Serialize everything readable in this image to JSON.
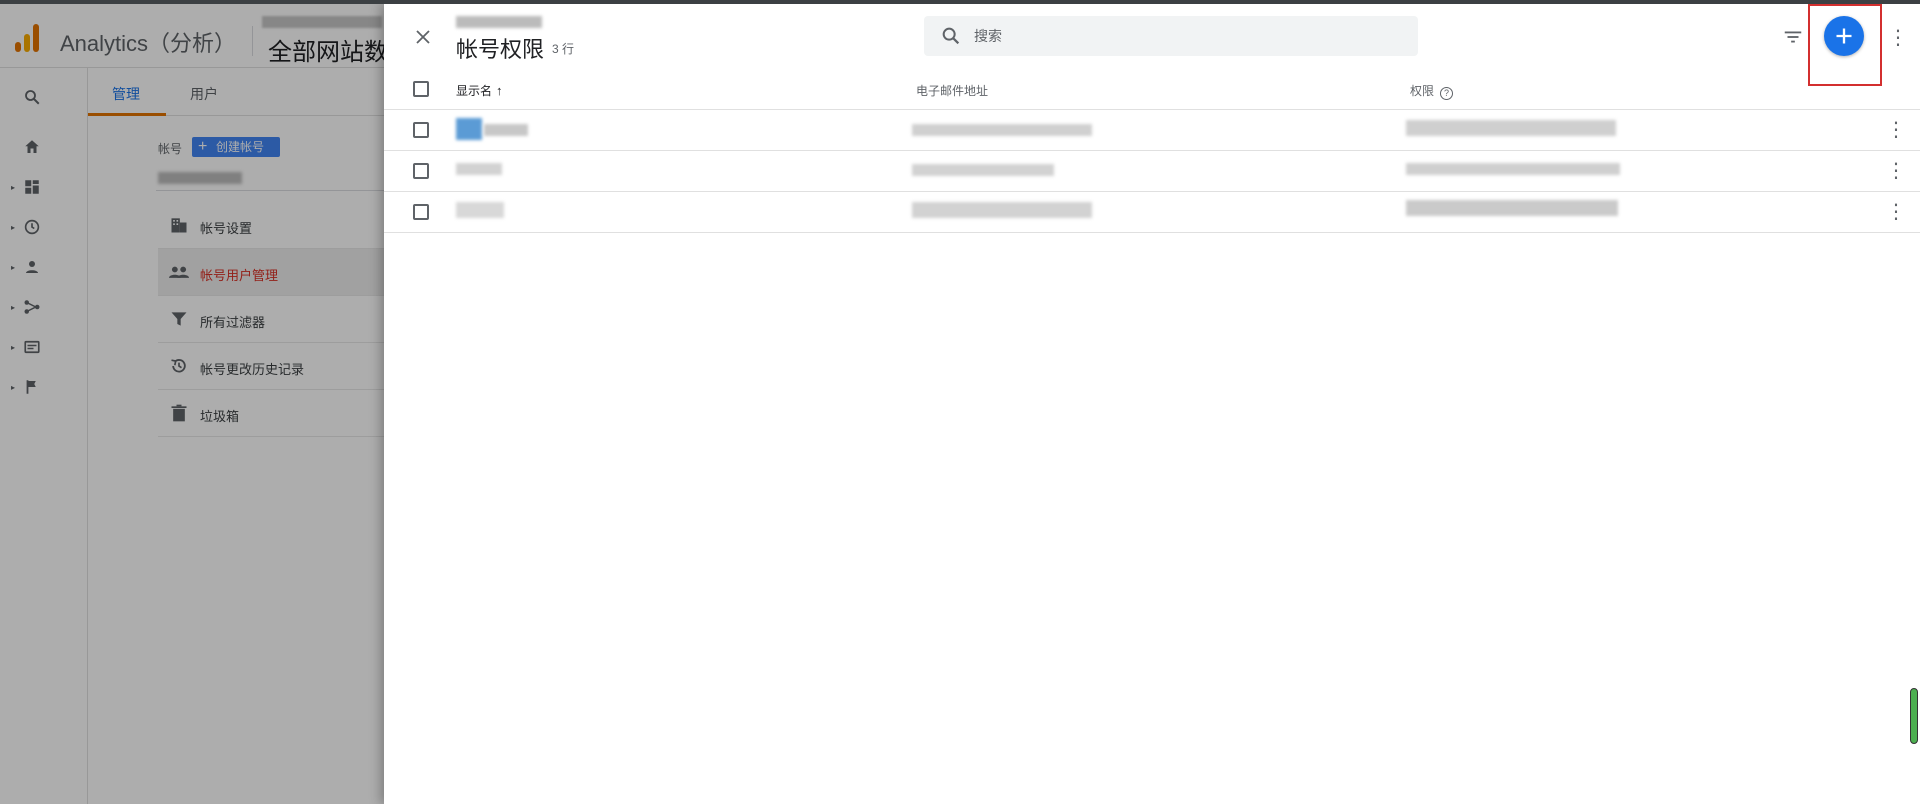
{
  "app": {
    "title": "Analytics（分析）",
    "account_title": "全部网站数据"
  },
  "admin": {
    "tabs": [
      {
        "label": "管理"
      },
      {
        "label": "用户"
      }
    ],
    "account_label": "帐号",
    "create_account_label": "创建帐号",
    "menu": [
      {
        "label": "帐号设置",
        "icon": "building-icon"
      },
      {
        "label": "帐号用户管理",
        "icon": "people-icon"
      },
      {
        "label": "所有过滤器",
        "icon": "filter-icon"
      },
      {
        "label": "帐号更改历史记录",
        "icon": "history-icon"
      },
      {
        "label": "垃圾箱",
        "icon": "trash-icon"
      }
    ]
  },
  "drawer": {
    "title": "帐号权限",
    "row_count": "3 行",
    "search": {
      "placeholder": "搜索",
      "value": ""
    },
    "columns": {
      "name": "显示名",
      "email": "电子邮件地址",
      "permissions": "权限"
    },
    "rows_count": 3
  },
  "colors": {
    "accent": "#1a73e8",
    "highlight": "#d32f2f",
    "active_menu_text": "#d93025",
    "tab_underline": "#e37400"
  }
}
